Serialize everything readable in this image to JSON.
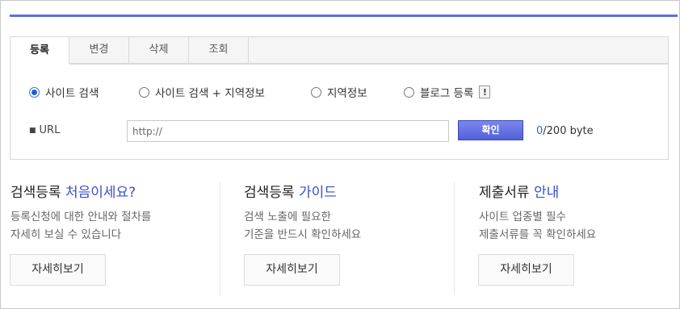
{
  "tabs": [
    {
      "label": "등록",
      "active": true
    },
    {
      "label": "변경",
      "active": false
    },
    {
      "label": "삭제",
      "active": false
    },
    {
      "label": "조회",
      "active": false
    }
  ],
  "options": [
    {
      "label": "사이트 검색",
      "selected": true
    },
    {
      "label": "사이트 검색 + 지역정보",
      "selected": false
    },
    {
      "label": "지역정보",
      "selected": false
    },
    {
      "label": "블로그 등록",
      "selected": false
    }
  ],
  "info_button": "!",
  "url": {
    "label": "URL",
    "value": "http://"
  },
  "confirm_label": "확인",
  "byte_counter": {
    "current": "0",
    "max": "/200 byte"
  },
  "columns": [
    {
      "title_main": "검색등록 ",
      "title_highlight": "처음이세요?",
      "desc_line1": "등록신청에 대한 안내와 절차를",
      "desc_line2": "자세히 보실 수 있습니다",
      "button": "자세히보기"
    },
    {
      "title_main": "검색등록 ",
      "title_highlight": "가이드",
      "desc_line1": "검색 노출에 필요한",
      "desc_line2": "기준을 반드시 확인하세요",
      "button": "자세히보기"
    },
    {
      "title_main": "제출서류 ",
      "title_highlight": "안내",
      "desc_line1": "사이트 업종별 필수",
      "desc_line2": "제출서류를 꼭 확인하세요",
      "button": "자세히보기"
    }
  ],
  "colors": {
    "accent": "#5b6fe0",
    "highlight": "#3a4fc8",
    "button": "#5461d9"
  }
}
